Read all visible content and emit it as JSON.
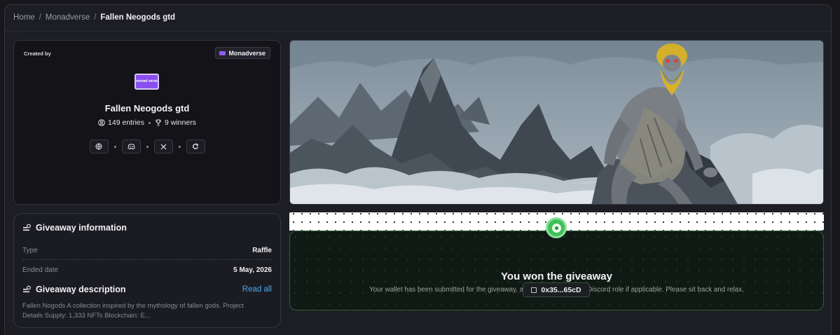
{
  "breadcrumb": {
    "items": [
      "Home",
      "Monadverse"
    ],
    "separator": "/",
    "current": "Fallen Neogods gtd"
  },
  "creator": {
    "created_by_label": "Created by",
    "creator_name": "Monadverse",
    "avatar_text": "monad verse",
    "project_title": "Fallen Neogods gtd",
    "entries": "149 entries",
    "winners": "9 winners",
    "socials": [
      "website-icon",
      "discord-icon",
      "x-icon",
      "link-icon"
    ]
  },
  "info": {
    "heading": "Giveaway information",
    "rows": [
      {
        "key": "Type",
        "value": "Raffle"
      },
      {
        "key": "Ended date",
        "value": "5 May, 2026"
      }
    ],
    "description_heading": "Giveaway description",
    "read_all": "Read all",
    "description": "Fallen Nogods A collection inspired by the mythology of fallen gods. Project Details Supply: 1,333 NFTs Blockchain: E..."
  },
  "result": {
    "title": "You won the giveaway",
    "subtitle": "Your wallet has been submitted for the giveaway, and you will receive a Discord role if applicable. Please sit back and relax.",
    "wallet": "0x35...65cD"
  },
  "colors": {
    "accent_link": "#4aa8f0",
    "success": "#3fbf5a",
    "brand_purple": "#8a4ff0"
  }
}
